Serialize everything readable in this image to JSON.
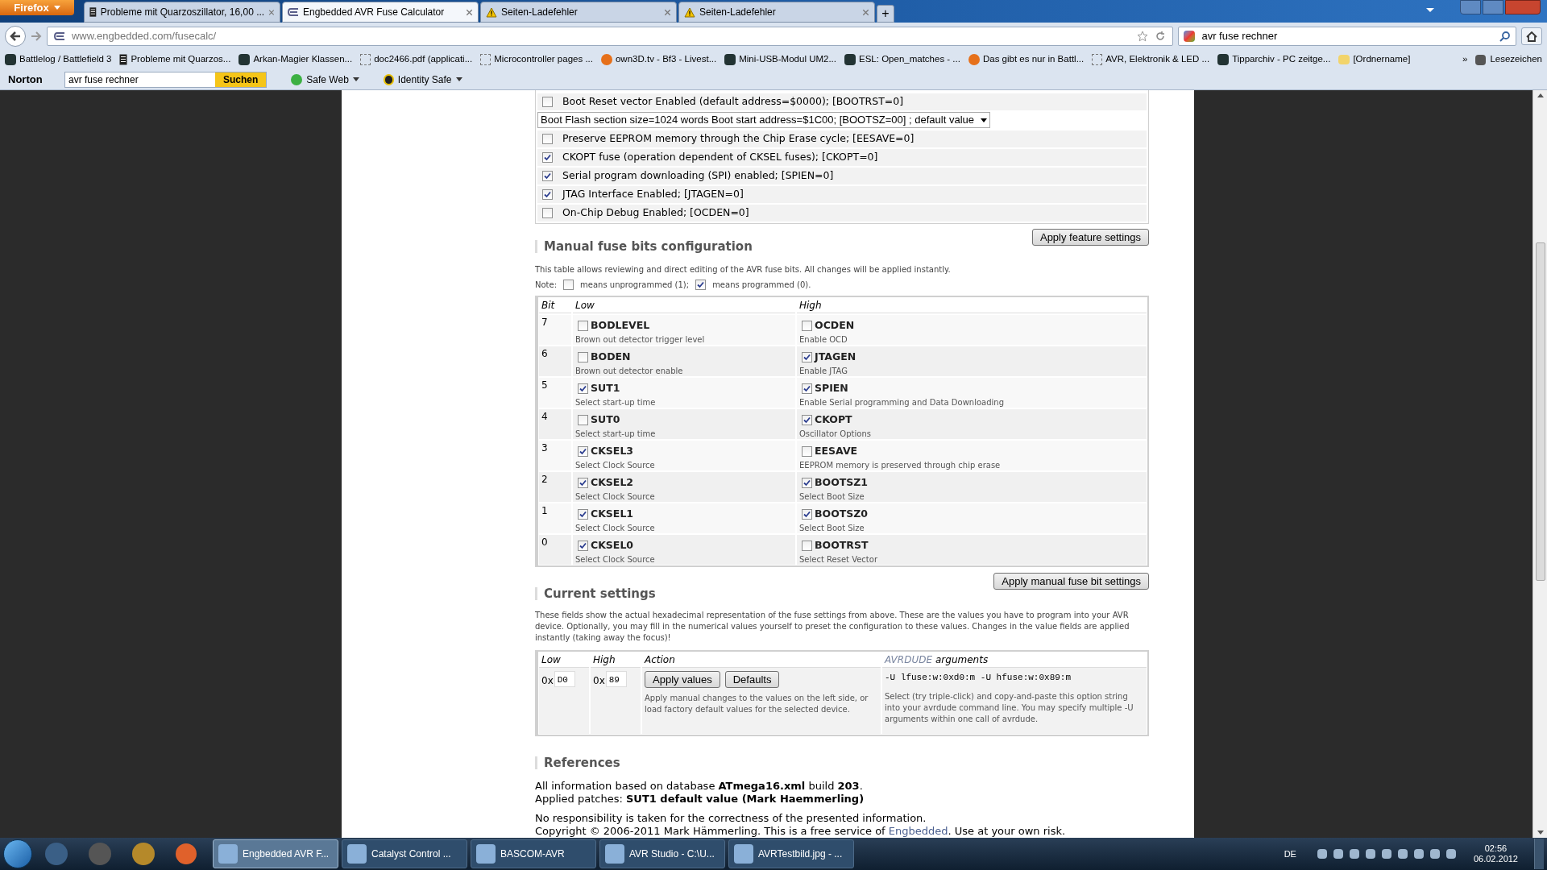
{
  "browser": {
    "menu_button": "Firefox",
    "tabs": [
      {
        "label": "Probleme mit Quarzoszillator, 16,00 ...",
        "selected": false
      },
      {
        "label": "Engbedded AVR Fuse Calculator",
        "selected": true
      },
      {
        "label": "Seiten-Ladefehler",
        "selected": false
      },
      {
        "label": "Seiten-Ladefehler",
        "selected": false
      }
    ],
    "new_tab": "+",
    "url": {
      "host": "www.engbedded.com",
      "path": "/fusecalc/"
    },
    "search_value": "avr fuse rechner",
    "bookmarks": [
      "Battlelog / Battlefield 3",
      "Probleme mit Quarzos...",
      "Arkan-Magier Klassen...",
      "doc2466.pdf (applicati...",
      "Microcontroller pages ...",
      "own3D.tv - Bf3 - Livest...",
      "Mini-USB-Modul UM2...",
      "ESL: Open_matches - ...",
      "Das gibt es nur in Battl...",
      "AVR, Elektronik & LED ...",
      "Tipparchiv - PC zeitge...",
      "[Ordnername]"
    ],
    "bookmarks_overflow": "»",
    "bookmarks_menu": "Lesezeichen",
    "norton": {
      "brand": "Norton",
      "search_value": "avr fuse rechner",
      "search_button": "Suchen",
      "items": [
        "Safe Web",
        "Identity Safe"
      ]
    }
  },
  "features": [
    {
      "kind": "checkbox",
      "label": "Boot Reset vector Enabled (default address=$0000); [BOOTRST=0]",
      "checked": false
    },
    {
      "kind": "select",
      "label": "Boot Flash section size=1024 words Boot start address=$1C00; [BOOTSZ=00] ; default value"
    },
    {
      "kind": "checkbox",
      "label": "Preserve EEPROM memory through the Chip Erase cycle; [EESAVE=0]",
      "checked": false
    },
    {
      "kind": "checkbox",
      "label": "CKOPT fuse (operation dependent of CKSEL fuses); [CKOPT=0]",
      "checked": true
    },
    {
      "kind": "checkbox",
      "label": "Serial program downloading (SPI) enabled; [SPIEN=0]",
      "checked": true
    },
    {
      "kind": "checkbox",
      "label": "JTAG Interface Enabled; [JTAGEN=0]",
      "checked": true
    },
    {
      "kind": "checkbox",
      "label": "On-Chip Debug Enabled; [OCDEN=0]",
      "checked": false
    }
  ],
  "apply_feature_button": "Apply feature settings",
  "manual": {
    "heading": "Manual fuse bits configuration",
    "description": "This table allows reviewing and direct editing of the AVR fuse bits. All changes will be applied instantly.",
    "note": {
      "prefix": "Note:",
      "unprogrammed": "means unprogrammed (1);",
      "unprogrammed_checked": false,
      "programmed": "means programmed (0).",
      "programmed_checked": true
    },
    "columns": [
      "Bit",
      "Low",
      "High"
    ],
    "rows": [
      {
        "bit": "7",
        "low": {
          "name": "BODLEVEL",
          "desc": "Brown out detector trigger level",
          "checked": false
        },
        "high": {
          "name": "OCDEN",
          "desc": "Enable OCD",
          "checked": false
        }
      },
      {
        "bit": "6",
        "low": {
          "name": "BODEN",
          "desc": "Brown out detector enable",
          "checked": false
        },
        "high": {
          "name": "JTAGEN",
          "desc": "Enable JTAG",
          "checked": true
        }
      },
      {
        "bit": "5",
        "low": {
          "name": "SUT1",
          "desc": "Select start-up time",
          "checked": true
        },
        "high": {
          "name": "SPIEN",
          "desc": "Enable Serial programming and Data Downloading",
          "checked": true
        }
      },
      {
        "bit": "4",
        "low": {
          "name": "SUT0",
          "desc": "Select start-up time",
          "checked": false
        },
        "high": {
          "name": "CKOPT",
          "desc": "Oscillator Options",
          "checked": true
        }
      },
      {
        "bit": "3",
        "low": {
          "name": "CKSEL3",
          "desc": "Select Clock Source",
          "checked": true
        },
        "high": {
          "name": "EESAVE",
          "desc": "EEPROM memory is preserved through chip erase",
          "checked": false
        }
      },
      {
        "bit": "2",
        "low": {
          "name": "CKSEL2",
          "desc": "Select Clock Source",
          "checked": true
        },
        "high": {
          "name": "BOOTSZ1",
          "desc": "Select Boot Size",
          "checked": true
        }
      },
      {
        "bit": "1",
        "low": {
          "name": "CKSEL1",
          "desc": "Select Clock Source",
          "checked": true
        },
        "high": {
          "name": "BOOTSZ0",
          "desc": "Select Boot Size",
          "checked": true
        }
      },
      {
        "bit": "0",
        "low": {
          "name": "CKSEL0",
          "desc": "Select Clock Source",
          "checked": true
        },
        "high": {
          "name": "BOOTRST",
          "desc": "Select Reset Vector",
          "checked": false
        }
      }
    ],
    "apply_button": "Apply manual fuse bit settings"
  },
  "current": {
    "heading": "Current settings",
    "description": "These fields show the actual hexadecimal representation of the fuse settings from above. These are the values you have to program into your AVR device. Optionally, you may fill in the numerical values yourself to preset the configuration to these values. Changes in the value fields are applied instantly (taking away the focus)!",
    "columns": [
      "Low",
      "High",
      "Action"
    ],
    "avrdude_column": {
      "tool": "AVRDUDE",
      "rest": "arguments"
    },
    "low": {
      "prefix": "0x",
      "value": "D0"
    },
    "high": {
      "prefix": "0x",
      "value": "89"
    },
    "buttons": [
      "Apply values",
      "Defaults"
    ],
    "action_description": "Apply manual changes to the values on the left side, or load factory default values for the selected device.",
    "avrdude_command": "-U lfuse:w:0xd0:m -U hfuse:w:0x89:m",
    "avrdude_description": "Select (try triple-click) and copy-and-paste this option string into your avrdude command line. You may specify multiple -U arguments within one call of avrdude."
  },
  "references": {
    "heading": "References",
    "lines": [
      "All information based on database **ATmega16.xml** build **203**.",
      "Applied patches: **SUT1 default value (Mark Haemmerling)**"
    ],
    "disclaimer": "No responsibility is taken for the correctness of the presented information.",
    "copyright": {
      "before": "Copyright © 2006-2011 Mark Hämmerling. This is a free service of ",
      "link": "Engbedded",
      "after": ". Use at your own risk."
    }
  },
  "taskbar": {
    "items": [
      {
        "label": "Engbedded AVR F...",
        "selected": true
      },
      {
        "label": "Catalyst Control ...",
        "selected": false
      },
      {
        "label": "BASCOM-AVR",
        "selected": false
      },
      {
        "label": "AVR Studio - C:\\U...",
        "selected": false
      },
      {
        "label": "AVRTestbild.jpg - ...",
        "selected": false
      }
    ],
    "language": "DE",
    "time": "02:56",
    "date": "06.02.2012"
  }
}
